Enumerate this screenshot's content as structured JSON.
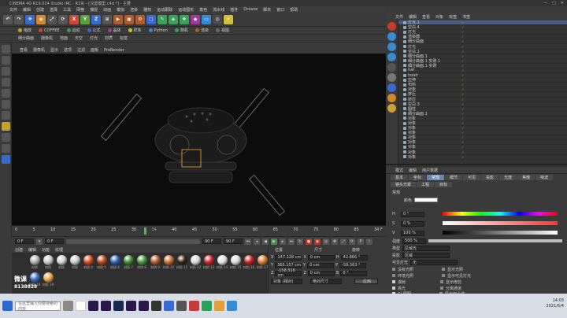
{
  "title": "CINEMA 4D R19.024 Studio (RC - R19) - [汉堡模型.c4d *] - 主要",
  "menu": [
    "文件",
    "编辑",
    "创建",
    "选择",
    "工具",
    "网格",
    "捕捉",
    "动画",
    "模拟",
    "渲染",
    "雕刻",
    "运动跟踪",
    "运动图形",
    "角色",
    "流水线",
    "插件",
    "Octane",
    "脚本",
    "窗口",
    "帮助"
  ],
  "toolbar": {
    "undo": "↶",
    "x": "X",
    "y": "Y",
    "z": "Z"
  },
  "toolbar2": [
    "缩放",
    "COFFEE",
    "运动",
    "公式",
    "晶体",
    "样条",
    "Python",
    "随机",
    "渲染",
    "视图"
  ],
  "toolbar3": [
    "细分曲面",
    "摄像机",
    "地面",
    "天空",
    "灯光",
    "材质",
    "标签"
  ],
  "viewport_menu": [
    "查看",
    "摄像机",
    "显示",
    "选项",
    "过滤",
    "面板",
    "ProRender"
  ],
  "timeline": {
    "ticks": [
      "0",
      "5",
      "10",
      "15",
      "20",
      "25",
      "30",
      "35",
      "40",
      "45",
      "50",
      "55",
      "60",
      "65",
      "70",
      "75",
      "80",
      "85",
      "90"
    ],
    "current_frame": "34",
    "end_label": "34 F"
  },
  "playbar": {
    "start": "0 F",
    "current": "0 F",
    "end": "90 F",
    "end2": "90 F"
  },
  "material_menu": [
    "创建",
    "编辑",
    "功能",
    "纹理"
  ],
  "materials": [
    {
      "name": "材质",
      "color": "#b0b0b0"
    },
    {
      "name": "材质",
      "color": "#c8c8c8"
    },
    {
      "name": "材质",
      "color": "#d0d0d0"
    },
    {
      "name": "材质",
      "color": "#c8c8c8"
    },
    {
      "name": "材质.4",
      "color": "#d64a1a"
    },
    {
      "name": "材质.5",
      "color": "#b84a1e"
    },
    {
      "name": "材质.6",
      "color": "#2a5fb0"
    },
    {
      "name": "材质.7",
      "color": "#3a8a2a"
    },
    {
      "name": "材质.8",
      "color": "#4a9a3a"
    },
    {
      "name": "材质.9",
      "color": "#a85a2a"
    },
    {
      "name": "材质.10",
      "color": "#c86a2a"
    },
    {
      "name": "材质.11",
      "color": "#3a2010"
    },
    {
      "name": "材质.12",
      "color": "#d8d8d8"
    },
    {
      "name": "材质.13",
      "color": "#d0202a"
    },
    {
      "name": "材质.14",
      "color": "#e0e0e0"
    },
    {
      "name": "材质.15",
      "color": "#d8d8d8"
    },
    {
      "name": "材质.16",
      "color": "#c82020"
    },
    {
      "name": "材质.17",
      "color": "#d87a2a"
    },
    {
      "name": "材质.18",
      "color": "#3a6ac0"
    },
    {
      "name": "材质.19",
      "color": "#e8a040"
    }
  ],
  "coords": {
    "headers": [
      "位置",
      "尺寸",
      "旋转"
    ],
    "rows": [
      {
        "axis": "X",
        "pos": "147.128 cm",
        "size": "0 cm",
        "rot_axis": "H",
        "rot": "42.866 °"
      },
      {
        "axis": "Y",
        "pos": "365.157 cm",
        "size": "0 cm",
        "rot_axis": "P",
        "rot": "-59.363 °"
      },
      {
        "axis": "Z",
        "pos": "-158.516 cm",
        "size": "0 cm",
        "rot_axis": "B",
        "rot": "0 °"
      }
    ],
    "mode": "对象 (相对)",
    "size_mode": "绝对尺寸",
    "apply": "应用"
  },
  "object_menu": [
    "文件",
    "编辑",
    "查看",
    "对象",
    "标签",
    "书签"
  ],
  "objects": [
    {
      "name": "灯光.1",
      "selected": true
    },
    {
      "name": "空白.4"
    },
    {
      "name": "灯光"
    },
    {
      "name": "渲染器"
    },
    {
      "name": "细分曲面"
    },
    {
      "name": "灯光"
    },
    {
      "name": "空白.1"
    },
    {
      "name": "细分曲面.1"
    },
    {
      "name": "细分曲面.1 实例.1"
    },
    {
      "name": "细分曲面.1 实例"
    },
    {
      "name": "hat"
    },
    {
      "name": "hood"
    },
    {
      "name": "拉伸"
    },
    {
      "name": "布料"
    },
    {
      "name": "对象"
    },
    {
      "name": "挤压"
    },
    {
      "name": "挤压"
    },
    {
      "name": "空白.3"
    },
    {
      "name": "圆柱"
    },
    {
      "name": "细分曲面.1"
    },
    {
      "name": "对象"
    },
    {
      "name": "对象"
    },
    {
      "name": "对象"
    },
    {
      "name": "对象"
    },
    {
      "name": "对象"
    },
    {
      "name": "对象"
    },
    {
      "name": "对象"
    },
    {
      "name": "对象"
    },
    {
      "name": "对象"
    }
  ],
  "attr_menu": [
    "模式",
    "编辑",
    "用户数据"
  ],
  "attr_title": "灯光对象 [灯光.1]",
  "attr_tabs": [
    "基本",
    "坐标",
    "常规",
    "细节",
    "可见",
    "投影",
    "光度",
    "焦散",
    "噪波"
  ],
  "attr_tabs2": [
    "镜头光晕",
    "工程",
    "目标"
  ],
  "attr": {
    "section": "常规",
    "color_label": "颜色",
    "h": "0 °",
    "s": "0 %",
    "v": "100 %",
    "intensity_label": "强度",
    "intensity": "500 %",
    "type_label": "类型",
    "type": "区域光",
    "shadow_label": "投影",
    "shadow": "区域",
    "visible_label": "可见灯光",
    "visible": "无",
    "noclip": "没有光照",
    "ambient": "环境光照",
    "diffuse": "漫射",
    "specular": "高光",
    "gi": "GI 照明",
    "show_light": "显示光照",
    "show_vis": "显示可见灯光",
    "show_clip": "显示修剪",
    "separate": "分离通道",
    "export": "导出到合成"
  },
  "watermark": {
    "line1": "微课",
    "line2": "8138828"
  },
  "taskbar": {
    "search": "在这里输入你要搜索的内容",
    "time": "14:03",
    "date": "2021/6/4"
  }
}
